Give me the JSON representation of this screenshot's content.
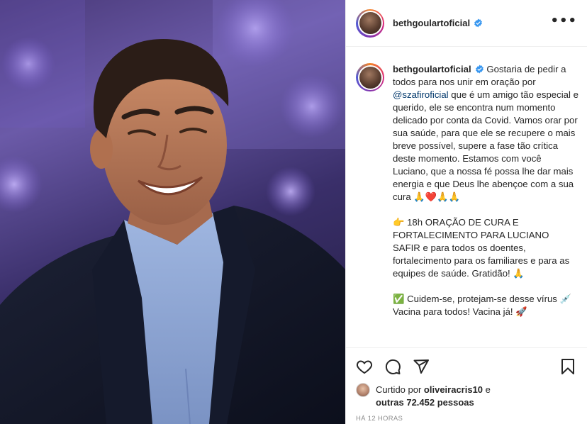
{
  "post": {
    "username": "beth​goulartoficial",
    "more_label": "•••"
  },
  "caption": {
    "username": "bethgoulartoficial",
    "part1": "Gostaria de pedir a todos para nos unir em oração por ",
    "mention": "@szafiroficial",
    "part2": " que é um amigo tão especial e querido, ele se encontra num momento delicado por conta da Covid. Vamos orar por sua saúde, para que ele se recupere o mais breve possível, supere a fase tão crítica deste momento. Estamos com você Luciano, que a nossa fé possa lhe dar mais energia e que Deus lhe abençoe com a sua cura 🙏❤️🙏🙏",
    "part3": "👉 18h ORAÇÃO DE CURA E FORTALECIMENTO PARA LUCIANO SAFIR e para todos os doentes, fortalecimento para os familiares e para as equipes de saúde. Gratidão! 🙏",
    "part4": "✅ Cuidem-se, protejam-se desse vírus 💉 Vacina para todos! Vacina já! 🚀"
  },
  "likes": {
    "prefix": "Curtido por ",
    "user": "oliveiracris10",
    "mid": " e ",
    "others": "outras 72.452 pessoas"
  },
  "timestamp": "HÁ 12 HORAS",
  "icons": {
    "like": "heart-icon",
    "comment": "comment-icon",
    "share": "share-icon",
    "save": "bookmark-icon",
    "verified": "verified-badge-icon",
    "more": "more-options-icon"
  },
  "colors": {
    "verified": "#3897f0",
    "mention": "#00376b",
    "muted": "#8e8e8e"
  }
}
